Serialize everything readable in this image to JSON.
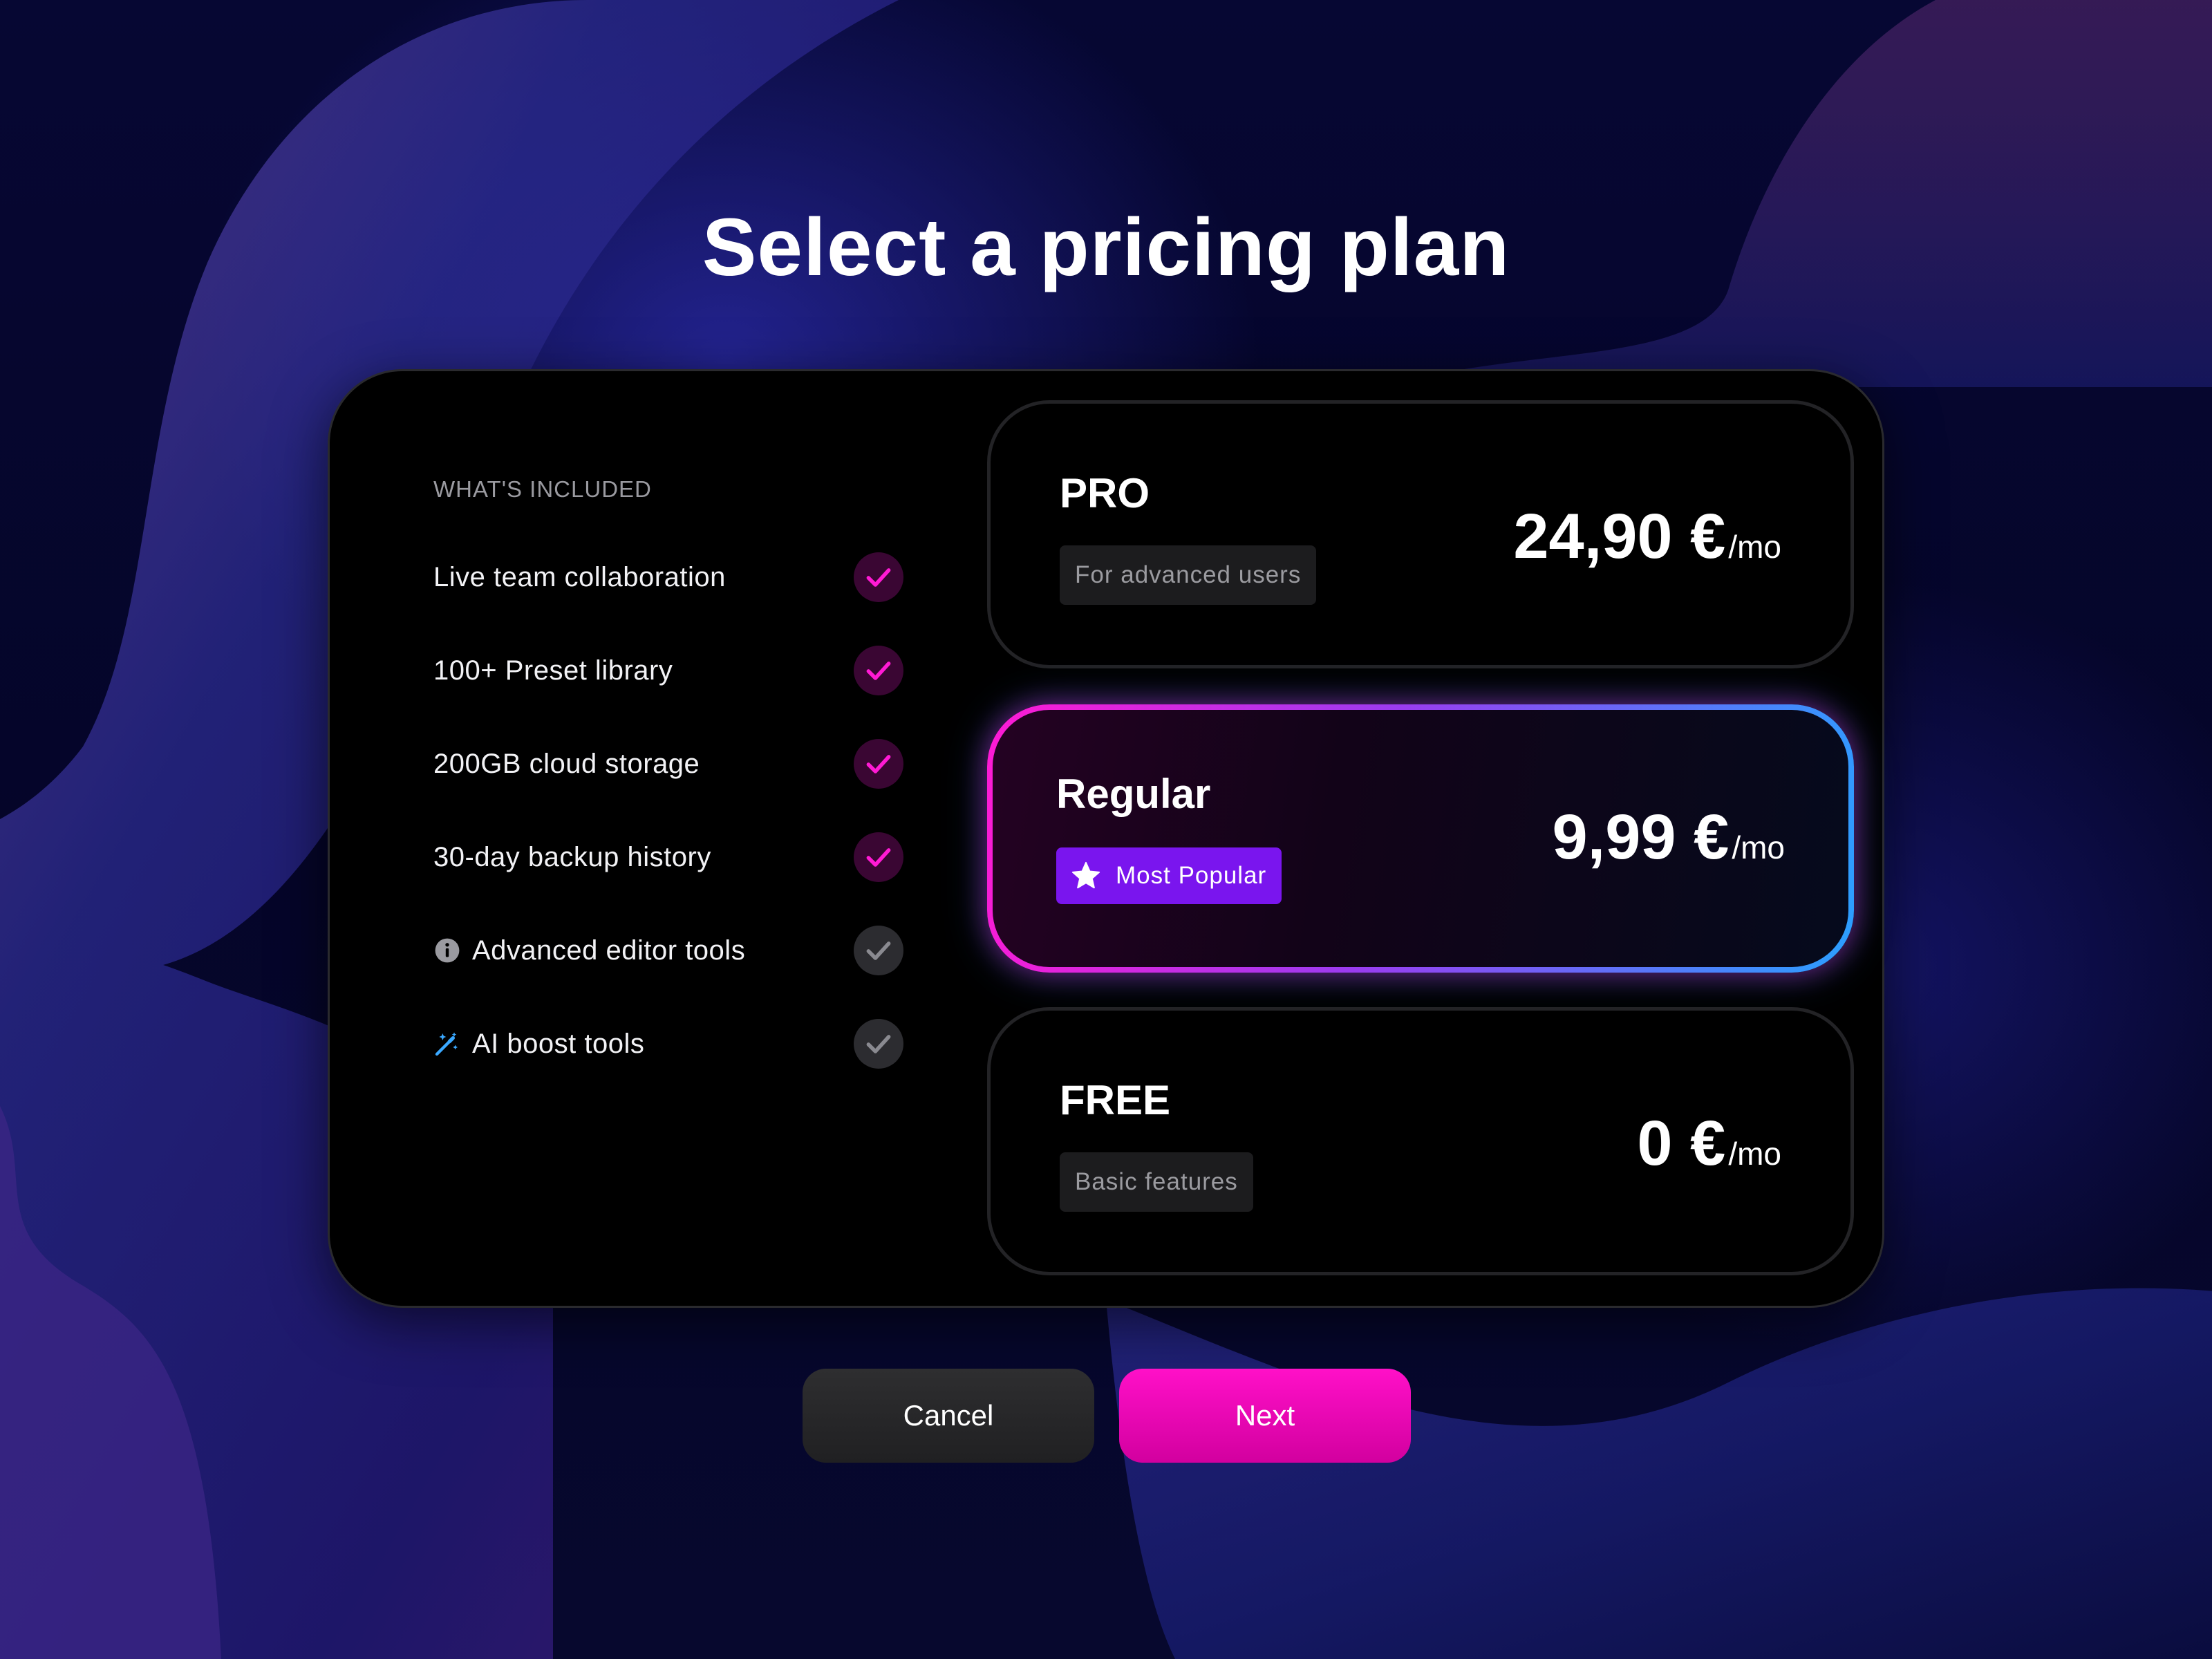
{
  "page": {
    "title": "Select a pricing plan"
  },
  "included": {
    "header": "WHAT'S INCLUDED",
    "features": [
      {
        "label": "Live team collaboration",
        "checked": true,
        "icon": null
      },
      {
        "label": "100+ Preset library",
        "checked": true,
        "icon": null
      },
      {
        "label": "200GB cloud storage",
        "checked": true,
        "icon": null
      },
      {
        "label": "30-day backup history",
        "checked": true,
        "icon": null
      },
      {
        "label": "Advanced editor tools",
        "checked": false,
        "icon": "info-icon"
      },
      {
        "label": "AI boost tools",
        "checked": false,
        "icon": "magic-wand-icon"
      }
    ]
  },
  "plans": [
    {
      "name": "PRO",
      "tag": "For advanced users",
      "price": "24,90 €",
      "unit": "/mo",
      "selected": false
    },
    {
      "name": "Regular",
      "tag": "Most Popular",
      "tag_icon": "star-icon",
      "price": "9,99 €",
      "unit": "/mo",
      "selected": true
    },
    {
      "name": "FREE",
      "tag": "Basic features",
      "price": "0 €",
      "unit": "/mo",
      "selected": false
    }
  ],
  "buttons": {
    "cancel": "Cancel",
    "next": "Next"
  },
  "colors": {
    "accent_pink": "#ff10c8",
    "accent_purple": "#7a15ee",
    "accent_blue": "#2aa0ff",
    "check_on": "#ff1ad4",
    "check_off": "#8a8a90"
  }
}
